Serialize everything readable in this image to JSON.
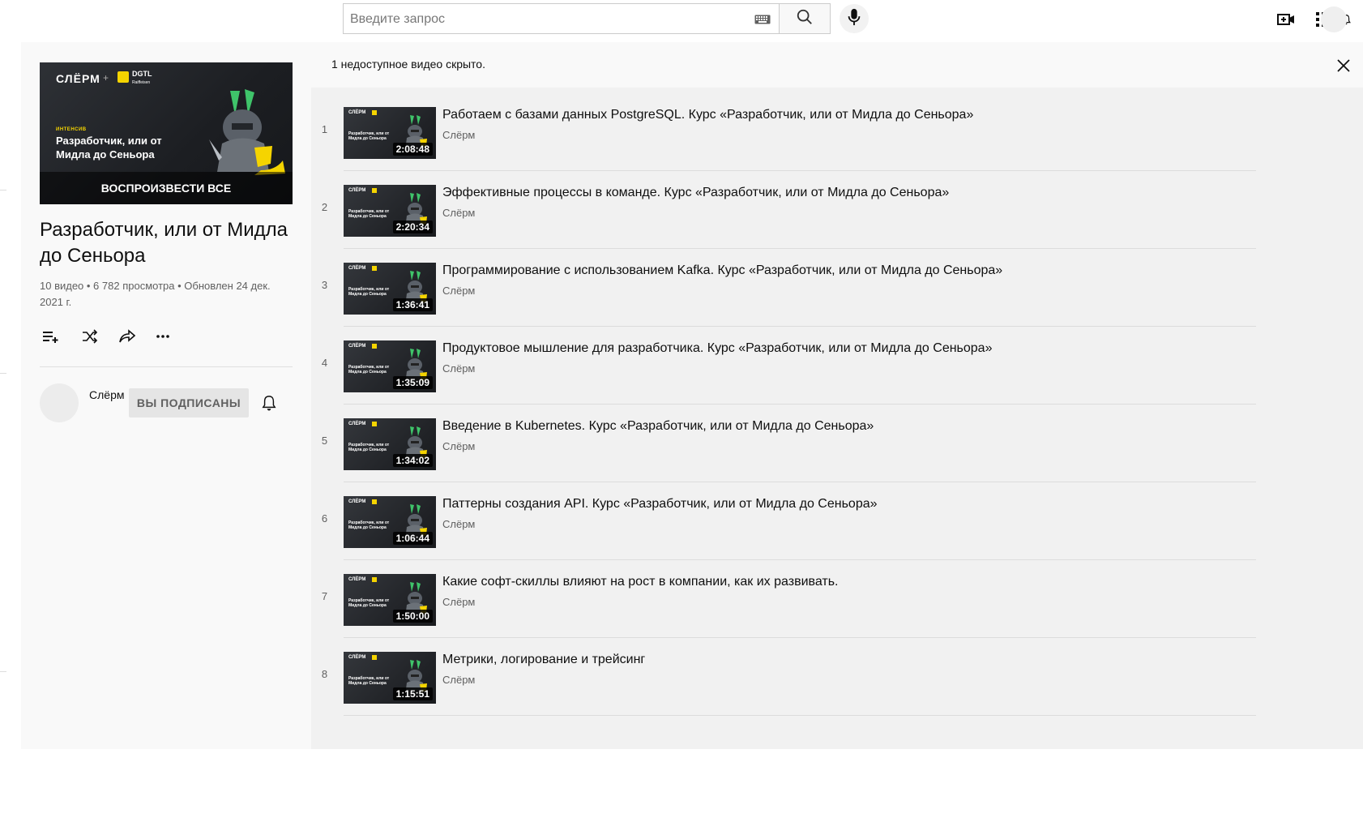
{
  "header": {
    "search_placeholder": "Введите запрос"
  },
  "notice": {
    "text": "1 недоступное видео скрыто."
  },
  "playlist": {
    "cover": {
      "brand": "СЛЁРМ",
      "partner": "DGTL",
      "partner_sub": "Raiffeisen",
      "kicker": "ИНТЕНСИВ",
      "title": "Разработчик, или от Мидла до Сеньора",
      "play_all_label": "ВОСПРОИЗВЕСТИ ВСЕ"
    },
    "title": "Разработчик, или от Мидла до Сеньора",
    "meta": "10 видео • 6 782 просмотра • Обновлен 24 дек. 2021 г.",
    "channel_name": "Слёрм",
    "subscribe_label": "ВЫ ПОДПИСАНЫ"
  },
  "videos": [
    {
      "index": "1",
      "title": "Работаем с базами данных PostgreSQL. Курс «Разработчик, или от Мидла до Сеньора»",
      "channel": "Слёрм",
      "duration": "2:08:48"
    },
    {
      "index": "2",
      "title": "Эффективные процессы в команде. Курс «Разработчик, или от Мидла до Сеньора»",
      "channel": "Слёрм",
      "duration": "2:20:34"
    },
    {
      "index": "3",
      "title": "Программирование с использованием Kafka. Курс «Разработчик, или от Мидла до Сеньора»",
      "channel": "Слёрм",
      "duration": "1:36:41"
    },
    {
      "index": "4",
      "title": "Продуктовое мышление для разработчика. Курс «Разработчик, или от Мидла до Сеньора»",
      "channel": "Слёрм",
      "duration": "1:35:09"
    },
    {
      "index": "5",
      "title": "Введение в Kubernetes. Курс «Разработчик, или от Мидла до Сеньора»",
      "channel": "Слёрм",
      "duration": "1:34:02"
    },
    {
      "index": "6",
      "title": "Паттерны создания API. Курс «Разработчик, или от Мидла до Сеньора»",
      "channel": "Слёрм",
      "duration": "1:06:44"
    },
    {
      "index": "7",
      "title": "Какие софт-скиллы влияют на рост в компании, как их развивать.",
      "channel": "Слёрм",
      "duration": "1:50:00"
    },
    {
      "index": "8",
      "title": "Метрики, логирование и трейсинг",
      "channel": "Слёрм",
      "duration": "1:15:51"
    }
  ],
  "icons": {
    "keyboard": "keyboard-icon",
    "search": "search-icon",
    "mic": "mic-icon",
    "create": "create-video-icon",
    "apps": "apps-grid-icon",
    "notifications": "bell-icon",
    "close": "close-icon",
    "save": "add-to-queue-icon",
    "shuffle": "shuffle-icon",
    "share": "share-icon",
    "more": "more-icon"
  },
  "colors": {
    "accent_yellow": "#f5d400",
    "list_background": "#f1f1f1",
    "sidebar_background": "#f9f9f9"
  }
}
